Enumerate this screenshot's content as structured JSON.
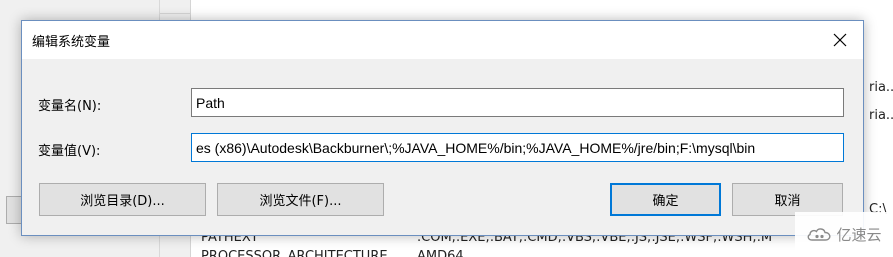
{
  "background": {
    "right_fragments": [
      "ria...",
      "ria..."
    ],
    "row_fragments": [
      {
        "name": "PATHEXT",
        "value": ".COM;.EXE;.BAT;.CMD;.VBS;.VBE;.JS;.JSE;.WSF;.WSH;.M"
      },
      {
        "name": "PROCESSOR_ARCHITECTURE",
        "value": "AMD64"
      }
    ],
    "drive_fragment": "C:\\"
  },
  "dialog": {
    "title": "编辑系统变量",
    "name_label": "变量名(N):",
    "name_value": "Path",
    "value_label": "变量值(V):",
    "value_value": "es (x86)\\Autodesk\\Backburner\\;%JAVA_HOME%/bin;%JAVA_HOME%/jre/bin;F:\\mysql\\bin",
    "buttons": {
      "browse_dir": "浏览目录(D)...",
      "browse_file": "浏览文件(F)...",
      "ok": "确定",
      "cancel": "取消"
    }
  },
  "watermark": {
    "text": "亿速云"
  },
  "colors": {
    "accent": "#0078d7",
    "button_face": "#e1e1e1",
    "dialog_bg": "#f0f0f0"
  }
}
